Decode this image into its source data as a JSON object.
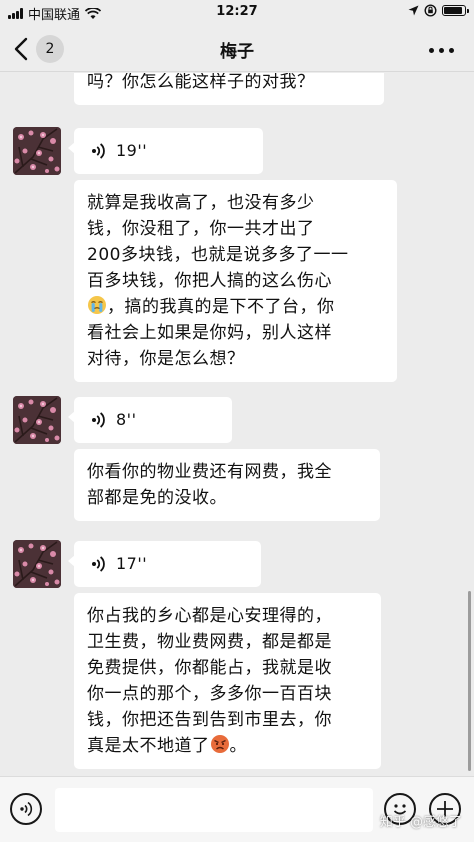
{
  "status_bar": {
    "carrier": "中国联通",
    "time": "12:27"
  },
  "nav": {
    "unread_count": "2",
    "title": "梅子"
  },
  "messages": [
    {
      "type": "text",
      "text": "吗？你怎么能这样子的对我？"
    },
    {
      "type": "voice",
      "duration": "19''"
    },
    {
      "type": "text",
      "lines": [
        "就算是我收高了，也没有多少",
        "钱，你没租了，你一共才出了",
        "200多块钱，也就是说多多了一一",
        "百多块钱，你把人搞的这么伤心",
        "，搞的我真的是下不了台，你",
        "看社会上如果是你妈，别人这样",
        "对待，你是怎么想？"
      ],
      "emoji": "crying-emoji"
    },
    {
      "type": "voice",
      "duration": "8''"
    },
    {
      "type": "text",
      "lines": [
        "你看你的物业费还有网费，我全",
        "部都是免的没收。"
      ]
    },
    {
      "type": "voice",
      "duration": "17''"
    },
    {
      "type": "text",
      "lines": [
        "你占我的乡心都是心安理得的，",
        "卫生费，物业费网费，都是都是",
        "免费提供，你都能占，我就是收",
        "你一点的那个，多多你一百百块",
        "钱，你把还告到告到市里去，你",
        "真是太不地道了",
        "。"
      ],
      "emoji": "angry-emoji"
    }
  ],
  "watermark": "知乎 @感悠了",
  "colors": {
    "background": "#ececec",
    "bubble": "#ffffff",
    "bar": "#ededed"
  }
}
